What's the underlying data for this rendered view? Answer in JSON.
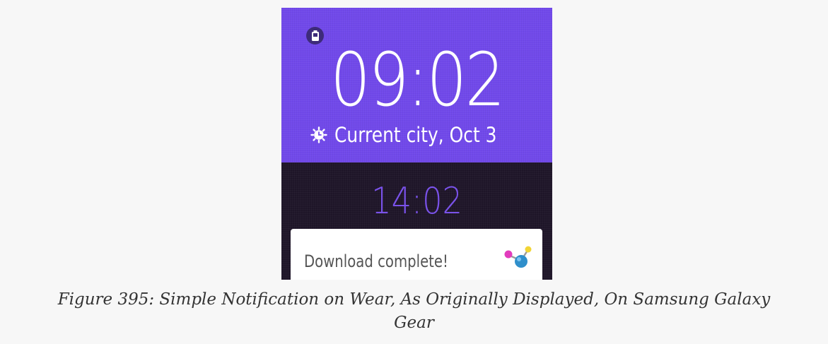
{
  "watch": {
    "main_time": "09:02",
    "location_date": "Current city, Oct 3",
    "secondary_time": "14:02",
    "notification": {
      "text": "Download complete!",
      "icon": "molecule-app-icon"
    },
    "battery_icon": "battery-icon",
    "weather_icon": "sun-clock-icon"
  },
  "caption": "Figure 395: Simple Notification on Wear, As Originally Displayed, On Samsung Galaxy Gear",
  "colors": {
    "top_panel": "#7149ea",
    "bottom_panel": "#1e1528",
    "secondary_time": "#7a52ea",
    "card": "#ffffff",
    "page_background": "#f7f7f7"
  }
}
